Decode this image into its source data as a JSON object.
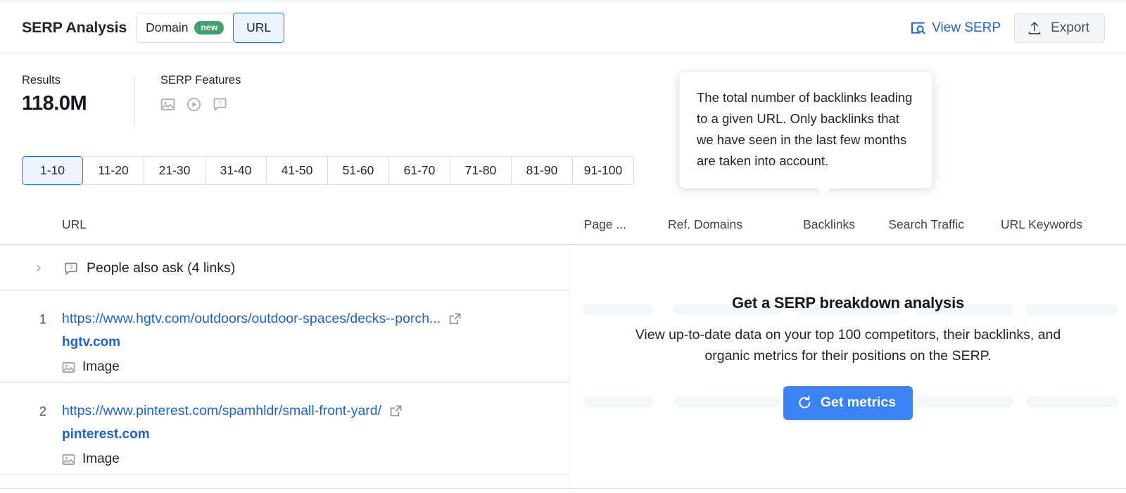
{
  "header": {
    "title": "SERP Analysis",
    "toggle": {
      "domain_label": "Domain",
      "new_badge": "new",
      "url_label": "URL",
      "selected": "URL"
    },
    "view_serp_label": "View SERP",
    "export_label": "Export",
    "link_color": "#1c63d5",
    "badge_color": "#46a06e"
  },
  "stats": {
    "results_label": "Results",
    "results_value": "118.0M",
    "features_label": "SERP Features",
    "features": [
      "image-icon",
      "video-icon",
      "people-also-ask-icon"
    ]
  },
  "pagination": {
    "active": "1-10",
    "pages": [
      "1-10",
      "11-20",
      "21-30",
      "31-40",
      "41-50",
      "51-60",
      "61-70",
      "71-80",
      "81-90",
      "91-100"
    ]
  },
  "tooltip": {
    "text": "The total number of backlinks leading to a given URL. Only backlinks that we have seen in the last few months are taken into account.",
    "points_to": "Backlinks"
  },
  "table": {
    "columns": {
      "url": "URL",
      "page": "Page ...",
      "ref_domains": "Ref. Domains",
      "backlinks": "Backlinks",
      "search_traffic": "Search Traffic",
      "url_keywords": "URL Keywords"
    },
    "paa_row": {
      "label": "People also ask (4 links)",
      "expander": "›"
    },
    "rows": [
      {
        "index": "1",
        "url": "https://www.hgtv.com/outdoors/outdoor-spaces/decks--porch...",
        "domain": "hgtv.com",
        "feature": "Image"
      },
      {
        "index": "2",
        "url": "https://www.pinterest.com/spamhldr/small-front-yard/",
        "domain": "pinterest.com",
        "feature": "Image"
      }
    ]
  },
  "promo": {
    "title": "Get a SERP breakdown analysis",
    "description": "View up-to-date data on your top 100 competitors, their backlinks, and organic metrics for their positions on the SERP.",
    "button_label": "Get metrics",
    "button_color": "#3b82f6"
  }
}
